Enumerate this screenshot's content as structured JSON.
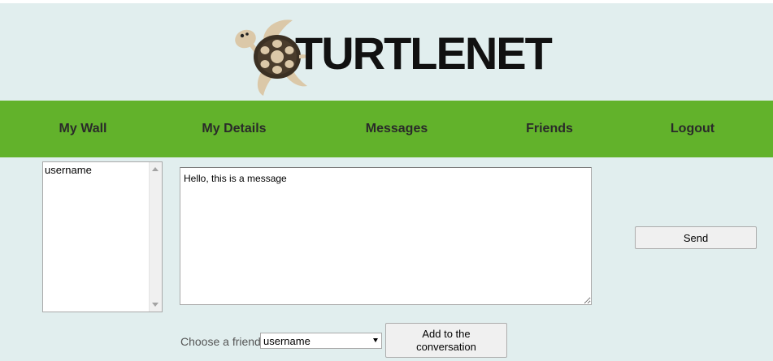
{
  "brand": {
    "name": "TURTLENET",
    "logo_icon": "turtle-icon"
  },
  "nav": {
    "items": [
      {
        "label": "My Wall"
      },
      {
        "label": "My Details"
      },
      {
        "label": "Messages"
      },
      {
        "label": "Friends"
      },
      {
        "label": "Logout"
      }
    ]
  },
  "conversation": {
    "participants": [
      "username"
    ],
    "message_value": "Hello, this is a message",
    "send_label": "Send"
  },
  "add_friend": {
    "label": "Choose a friend:",
    "selected": "username",
    "button_label": "Add to the conversation"
  },
  "colors": {
    "background": "#e1eeee",
    "nav_bar": "#62b22b",
    "nav_text": "#2a2a2a",
    "logo_text": "#111111"
  }
}
